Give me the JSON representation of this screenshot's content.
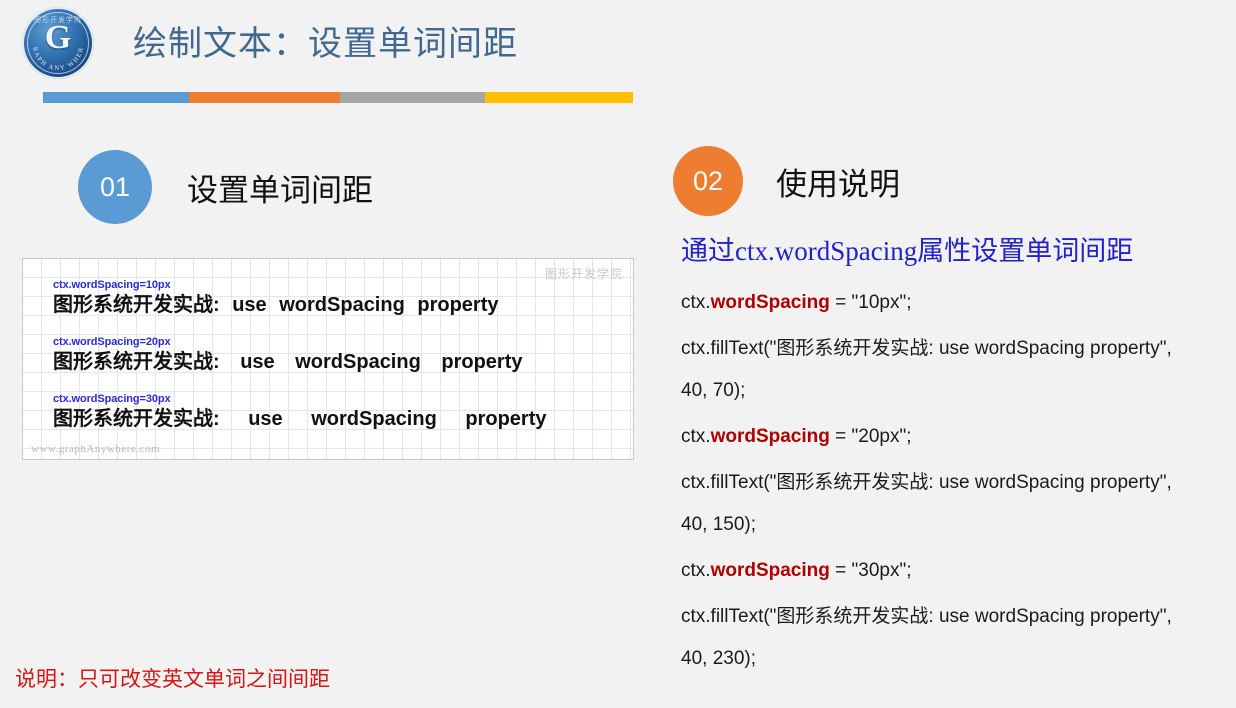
{
  "slide": {
    "background_color": "#f2f2f2",
    "title": "绘制文本：设置单词间距",
    "title_color": "#41688f"
  },
  "logo": {
    "name": "graph-anywhere-logo",
    "letter": "G",
    "top_text": "图形开发学院",
    "arc_text": "GRAPH ANY WHERE",
    "color": "#1b4e86"
  },
  "accent_bar": {
    "segments": [
      {
        "name": "blue",
        "color": "#5b9bd5"
      },
      {
        "name": "orange",
        "color": "#ed7d31"
      },
      {
        "name": "gray",
        "color": "#a5a5a5"
      },
      {
        "name": "yellow",
        "color": "#ffc000"
      }
    ]
  },
  "sections": [
    {
      "number": "01",
      "title": "设置单词间距",
      "badge_color": "#5b9bd5"
    },
    {
      "number": "02",
      "title": "使用说明",
      "badge_color": "#ed7d31"
    }
  ],
  "canvas_demo": {
    "watermark_top_right": "图形开发学院",
    "watermark_bottom_left": "www.graphAnywhere.com",
    "rows": [
      {
        "label": "ctx.wordSpacing=10px",
        "text": "图形系统开发实战:  use  wordSpacing  property",
        "spacing": "10px"
      },
      {
        "label": "ctx.wordSpacing=20px",
        "text": "图形系统开发实战:  use  wordSpacing  property",
        "spacing": "20px"
      },
      {
        "label": "ctx.wordSpacing=30px",
        "text": "图形系统开发实战:  use  wordSpacing  property",
        "spacing": "30px"
      }
    ]
  },
  "usage": {
    "heading": "通过ctx.wordSpacing属性设置单词间距",
    "lines": [
      {
        "prefix": "ctx.",
        "keyword": "wordSpacing",
        "suffix": " = \"10px\";"
      },
      {
        "plain": "ctx.fillText(\"图形系统开发实战: use wordSpacing property\", 40, 70);"
      },
      {
        "prefix": "ctx.",
        "keyword": "wordSpacing",
        "suffix": " = \"20px\";"
      },
      {
        "plain": "ctx.fillText(\"图形系统开发实战: use wordSpacing property\", 40, 150);"
      },
      {
        "prefix": "ctx.",
        "keyword": "wordSpacing",
        "suffix": " = \"30px\";"
      },
      {
        "plain": "ctx.fillText(\"图形系统开发实战: use wordSpacing property\", 40, 230);"
      }
    ],
    "keyword_color": "#b00000",
    "heading_color": "#2222cc"
  },
  "note": {
    "text": "说明：只可改变英文单词之间间距",
    "color": "#d81414"
  }
}
